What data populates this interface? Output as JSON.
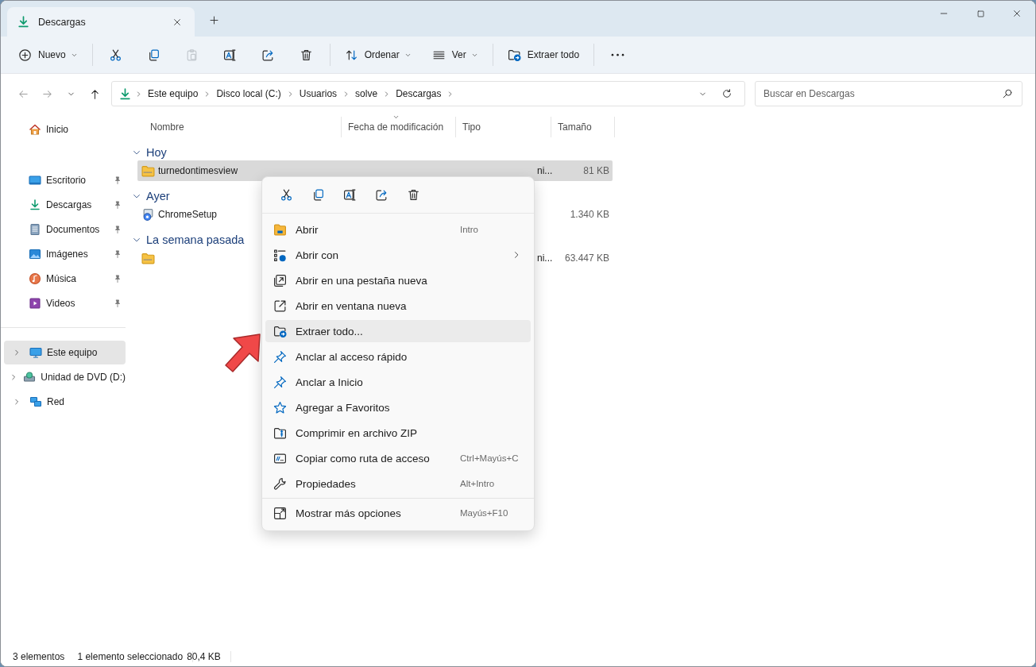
{
  "window": {
    "tab_title": "Descargas"
  },
  "toolbar": {
    "items": [
      {
        "kind": "new",
        "label": "Nuevo",
        "dropdown": true,
        "disabled": false
      },
      {
        "kind": "cut",
        "disabled": false
      },
      {
        "kind": "copy",
        "disabled": false
      },
      {
        "kind": "paste",
        "disabled": true
      },
      {
        "kind": "rename",
        "disabled": false
      },
      {
        "kind": "share",
        "disabled": false
      },
      {
        "kind": "delete",
        "disabled": false
      },
      {
        "kind": "sort",
        "label": "Ordenar",
        "dropdown": true,
        "disabled": false
      },
      {
        "kind": "view",
        "label": "Ver",
        "dropdown": true,
        "disabled": false
      },
      {
        "kind": "extract",
        "label": "Extraer todo",
        "disabled": false
      },
      {
        "kind": "more",
        "disabled": false
      }
    ]
  },
  "address": {
    "path": [
      "Este equipo",
      "Disco local (C:)",
      "Usuarios",
      "solve",
      "Descargas"
    ],
    "search_placeholder": "Buscar en Descargas"
  },
  "sidebar": {
    "home": [
      {
        "kind": "home",
        "label": "Inicio",
        "selected": false
      }
    ],
    "quick_access": [
      {
        "kind": "desktop",
        "label": "Escritorio",
        "pinned": true,
        "selected": false
      },
      {
        "kind": "downloads",
        "label": "Descargas",
        "pinned": true,
        "selected": false
      },
      {
        "kind": "documents",
        "label": "Documentos",
        "pinned": true,
        "selected": false
      },
      {
        "kind": "pictures",
        "label": "Imágenes",
        "pinned": true,
        "selected": false
      },
      {
        "kind": "music",
        "label": "Música",
        "pinned": true,
        "selected": false
      },
      {
        "kind": "videos",
        "label": "Videos",
        "pinned": true,
        "selected": false
      }
    ],
    "locations": [
      {
        "kind": "pc",
        "label": "Este equipo",
        "expanded": false,
        "selected": true
      },
      {
        "kind": "dvd",
        "label": "Unidad de DVD (D:)",
        "expanded": false,
        "selected": false
      },
      {
        "kind": "network",
        "label": "Red",
        "expanded": false,
        "selected": false
      }
    ]
  },
  "columns": [
    {
      "label": "Nombre",
      "sorted": false
    },
    {
      "label": "Fecha de modificación",
      "sorted": true
    },
    {
      "label": "Tipo",
      "sorted": false
    },
    {
      "label": "Tamaño",
      "sorted": false
    }
  ],
  "groups": [
    {
      "label": "Hoy",
      "expanded": true,
      "files": [
        {
          "kind": "zip",
          "name": "turnedontimesview",
          "type": "ni...",
          "size": "81 KB",
          "selected": true
        }
      ]
    },
    {
      "label": "Ayer",
      "expanded": true,
      "files": [
        {
          "kind": "setup",
          "name": "ChromeSetup",
          "size": "1.340 KB",
          "selected": false
        }
      ]
    },
    {
      "label": "La semana pasada",
      "expanded": true,
      "files": [
        {
          "kind": "zip",
          "type": "ni...",
          "size": "63.447 KB",
          "selected": false
        }
      ]
    }
  ],
  "context_menu": {
    "actions": [
      {
        "kind": "cut"
      },
      {
        "kind": "copy"
      },
      {
        "kind": "rename"
      },
      {
        "kind": "share"
      },
      {
        "kind": "delete"
      }
    ],
    "items": [
      {
        "kind": "open",
        "label": "Abrir",
        "shortcut": "Intro",
        "submenu": false,
        "selected": false
      },
      {
        "kind": "open_with",
        "label": "Abrir con",
        "submenu": true,
        "selected": false
      },
      {
        "kind": "new_tab",
        "label": "Abrir en una pestaña nueva",
        "submenu": false,
        "selected": false
      },
      {
        "kind": "new_window",
        "label": "Abrir en ventana nueva",
        "submenu": false,
        "selected": false
      },
      {
        "kind": "extract",
        "label": "Extraer todo...",
        "submenu": false,
        "selected": true
      },
      {
        "kind": "pin",
        "label": "Anclar al acceso rápido",
        "submenu": false,
        "selected": false
      },
      {
        "kind": "pin",
        "label": "Anclar a Inicio",
        "submenu": false,
        "selected": false
      },
      {
        "kind": "star",
        "label": "Agregar a Favoritos",
        "submenu": false,
        "selected": false
      },
      {
        "kind": "zip",
        "label": "Comprimir en archivo ZIP",
        "submenu": false,
        "selected": false
      },
      {
        "kind": "path",
        "label": "Copiar como ruta de acceso",
        "shortcut": "Ctrl+Mayús+C",
        "submenu": false,
        "selected": false
      },
      {
        "kind": "properties",
        "label": "Propiedades",
        "shortcut": "Alt+Intro",
        "submenu": false,
        "selected": false
      }
    ],
    "footer_items": [
      {
        "kind": "more_options",
        "label": "Mostrar más opciones",
        "shortcut": "Mayús+F10",
        "selected": false
      }
    ]
  },
  "status_bar": [
    "3 elementos",
    "1 elemento seleccionado",
    "80,4 KB"
  ]
}
